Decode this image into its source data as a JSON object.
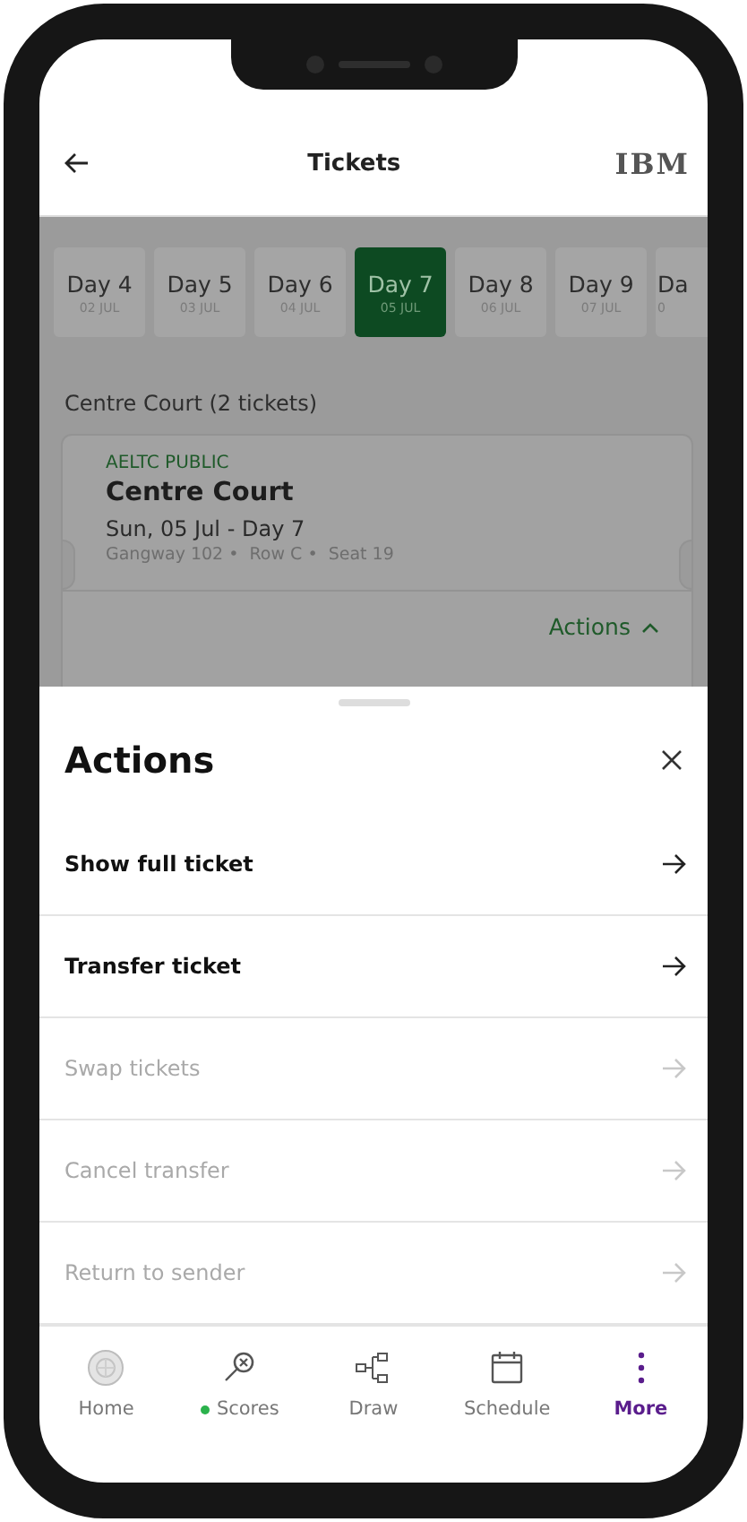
{
  "header": {
    "title": "Tickets",
    "logo": "IBM"
  },
  "days": [
    {
      "label": "Day 4",
      "date": "02 JUL",
      "selected": false
    },
    {
      "label": "Day 5",
      "date": "03 JUL",
      "selected": false
    },
    {
      "label": "Day 6",
      "date": "04 JUL",
      "selected": false
    },
    {
      "label": "Day 7",
      "date": "05 JUL",
      "selected": true
    },
    {
      "label": "Day 8",
      "date": "06 JUL",
      "selected": false
    },
    {
      "label": "Day 9",
      "date": "07 JUL",
      "selected": false
    },
    {
      "label": "Da",
      "date": "0",
      "selected": false
    }
  ],
  "section_title": "Centre Court (2 tickets)",
  "ticket": {
    "category": "AELTC PUBLIC",
    "court": "Centre Court",
    "date": "Sun, 05 Jul - Day 7",
    "seat": "Gangway 102 •  Row C •  Seat 19",
    "actions_label": "Actions",
    "actions_expanded": true
  },
  "sheet": {
    "title": "Actions",
    "items": [
      {
        "label": "Show full ticket",
        "disabled": false
      },
      {
        "label": "Transfer ticket",
        "disabled": false
      },
      {
        "label": "Swap tickets",
        "disabled": true
      },
      {
        "label": "Cancel transfer",
        "disabled": true
      },
      {
        "label": "Return to sender",
        "disabled": true
      }
    ]
  },
  "nav": [
    {
      "label": "Home",
      "kind": "home",
      "selected": false,
      "live": false
    },
    {
      "label": "Scores",
      "kind": "scores",
      "selected": false,
      "live": true
    },
    {
      "label": "Draw",
      "kind": "draw",
      "selected": false,
      "live": false
    },
    {
      "label": "Schedule",
      "kind": "schedule",
      "selected": false,
      "live": false
    },
    {
      "label": "More",
      "kind": "more",
      "selected": true,
      "live": false
    }
  ]
}
